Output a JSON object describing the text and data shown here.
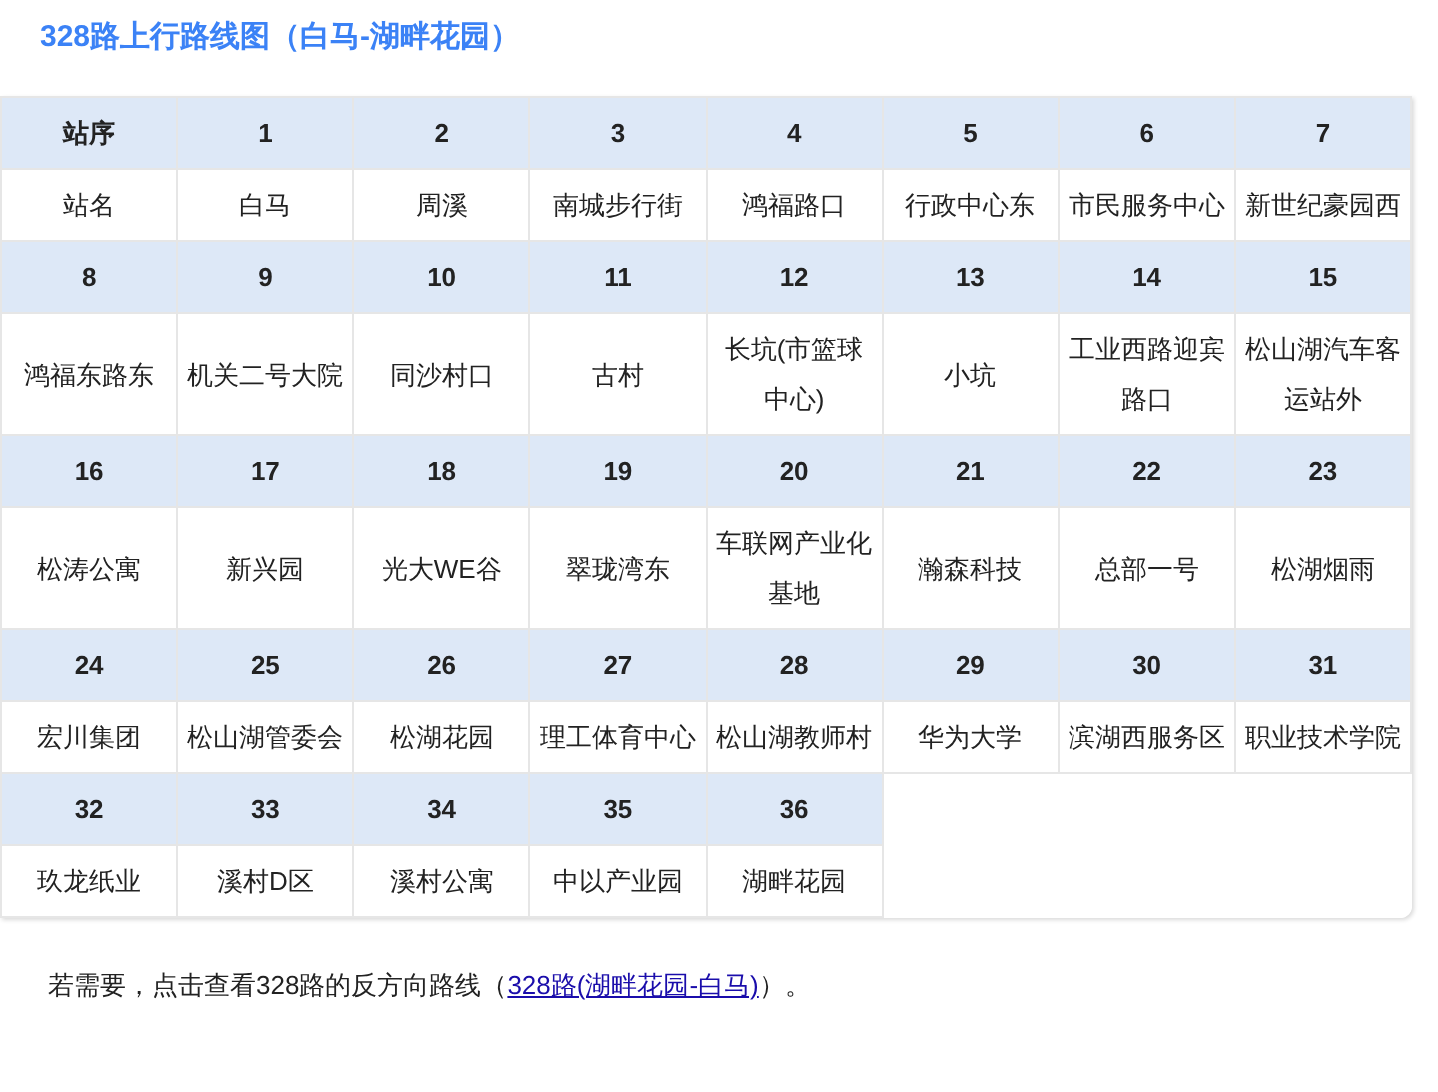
{
  "title": "328路上行路线图（白马-湖畔花园）",
  "table": {
    "rows": [
      {
        "numbers": [
          "站序",
          "1",
          "2",
          "3",
          "4",
          "5",
          "6",
          "7"
        ],
        "names": [
          "站名",
          "白马",
          "周溪",
          "南城步行街",
          "鸿福路口",
          "行政中心东",
          "市民服务中心",
          "新世纪豪园西"
        ]
      },
      {
        "numbers": [
          "8",
          "9",
          "10",
          "11",
          "12",
          "13",
          "14",
          "15"
        ],
        "names": [
          "鸿福东路东",
          "机关二号大院",
          "同沙村口",
          "古村",
          "长坑(市篮球中心)",
          "小坑",
          "工业西路迎宾路口",
          "松山湖汽车客运站外"
        ]
      },
      {
        "numbers": [
          "16",
          "17",
          "18",
          "19",
          "20",
          "21",
          "22",
          "23"
        ],
        "names": [
          "松涛公寓",
          "新兴园",
          "光大WE谷",
          "翠珑湾东",
          "车联网产业化基地",
          "瀚森科技",
          "总部一号",
          "松湖烟雨"
        ]
      },
      {
        "numbers": [
          "24",
          "25",
          "26",
          "27",
          "28",
          "29",
          "30",
          "31"
        ],
        "names": [
          "宏川集团",
          "松山湖管委会",
          "松湖花园",
          "理工体育中心",
          "松山湖教师村",
          "华为大学",
          "滨湖西服务区",
          "职业技术学院"
        ]
      },
      {
        "numbers": [
          "32",
          "33",
          "34",
          "35",
          "36"
        ],
        "names": [
          "玖龙纸业",
          "溪村D区",
          "溪村公寓",
          "中以产业园",
          "湖畔花园"
        ]
      }
    ]
  },
  "footer": {
    "text_before": "若需要，点击查看328路的反方向路线（",
    "link": "328路(湖畔花园-白马)",
    "text_after": "）。"
  }
}
